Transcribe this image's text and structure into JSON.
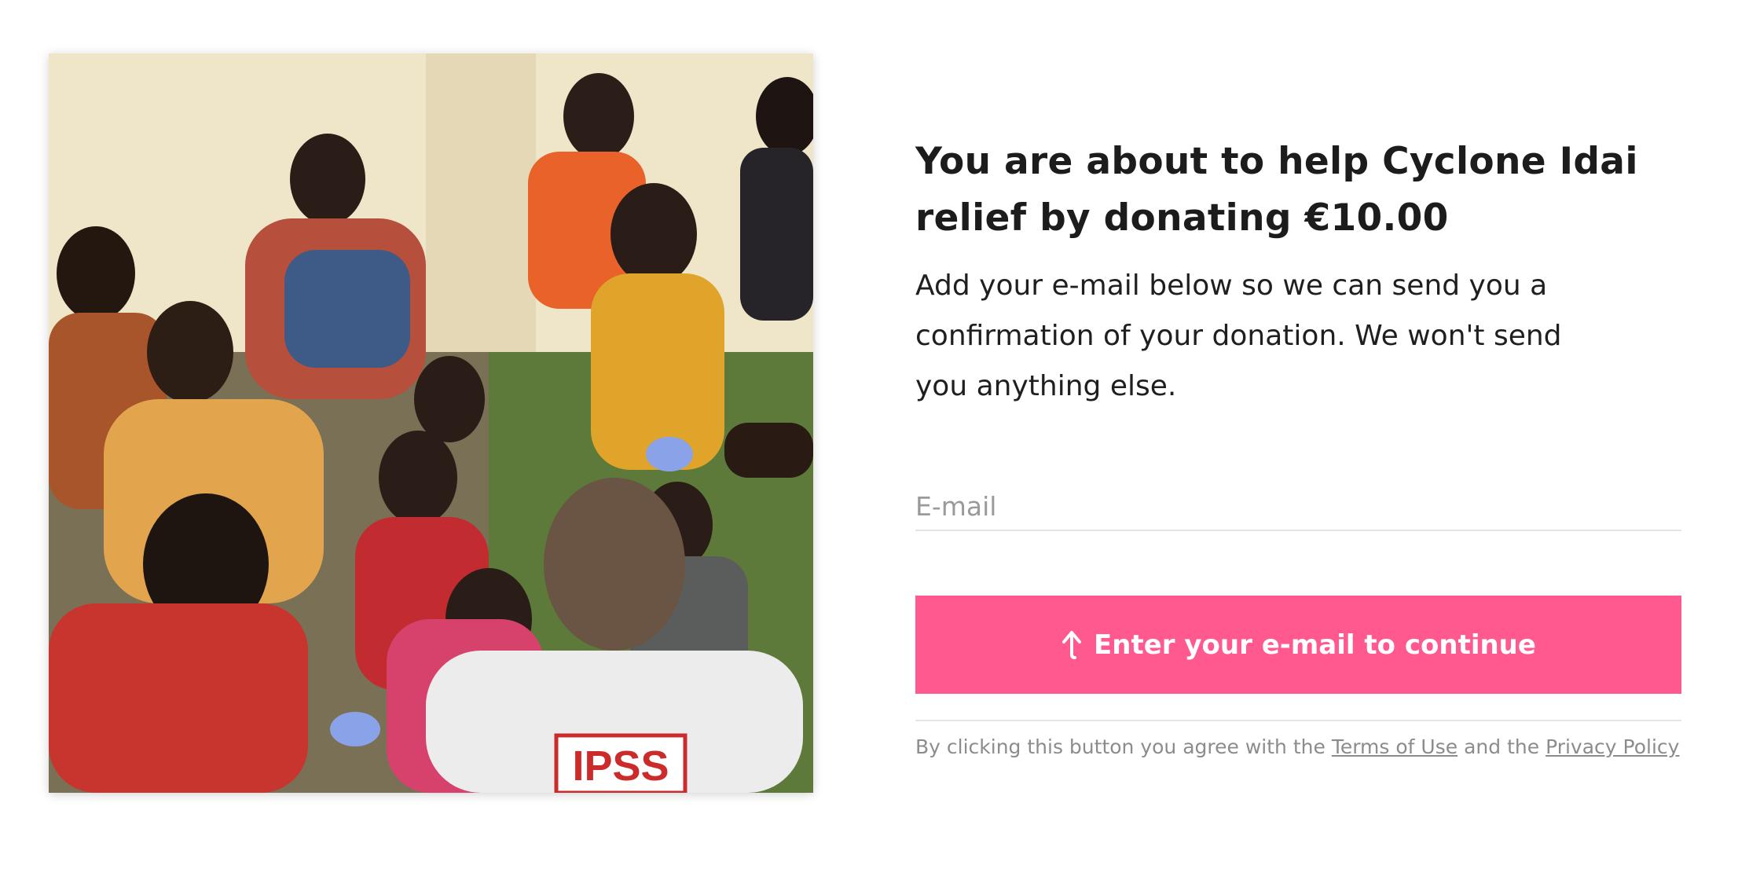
{
  "hero_image": {
    "logo_text": "IPSS"
  },
  "donation": {
    "heading": "You are about to help Cyclone Idai relief by donating €10.00",
    "description": "Add your e-mail below so we can send you a confirmation of your donation. We won't send you anything else."
  },
  "form": {
    "email_placeholder": "E-mail",
    "email_value": "",
    "continue_label": "Enter your e-mail to continue",
    "continue_icon": "arrow-up-icon"
  },
  "legal": {
    "prefix": "By clicking this button you agree with the",
    "terms_label": "Terms of Use",
    "middle": "and the",
    "privacy_label": "Privacy Policy"
  },
  "colors": {
    "accent": "#ff598f",
    "text": "#1c1c1c",
    "muted": "#8c8c8c"
  }
}
